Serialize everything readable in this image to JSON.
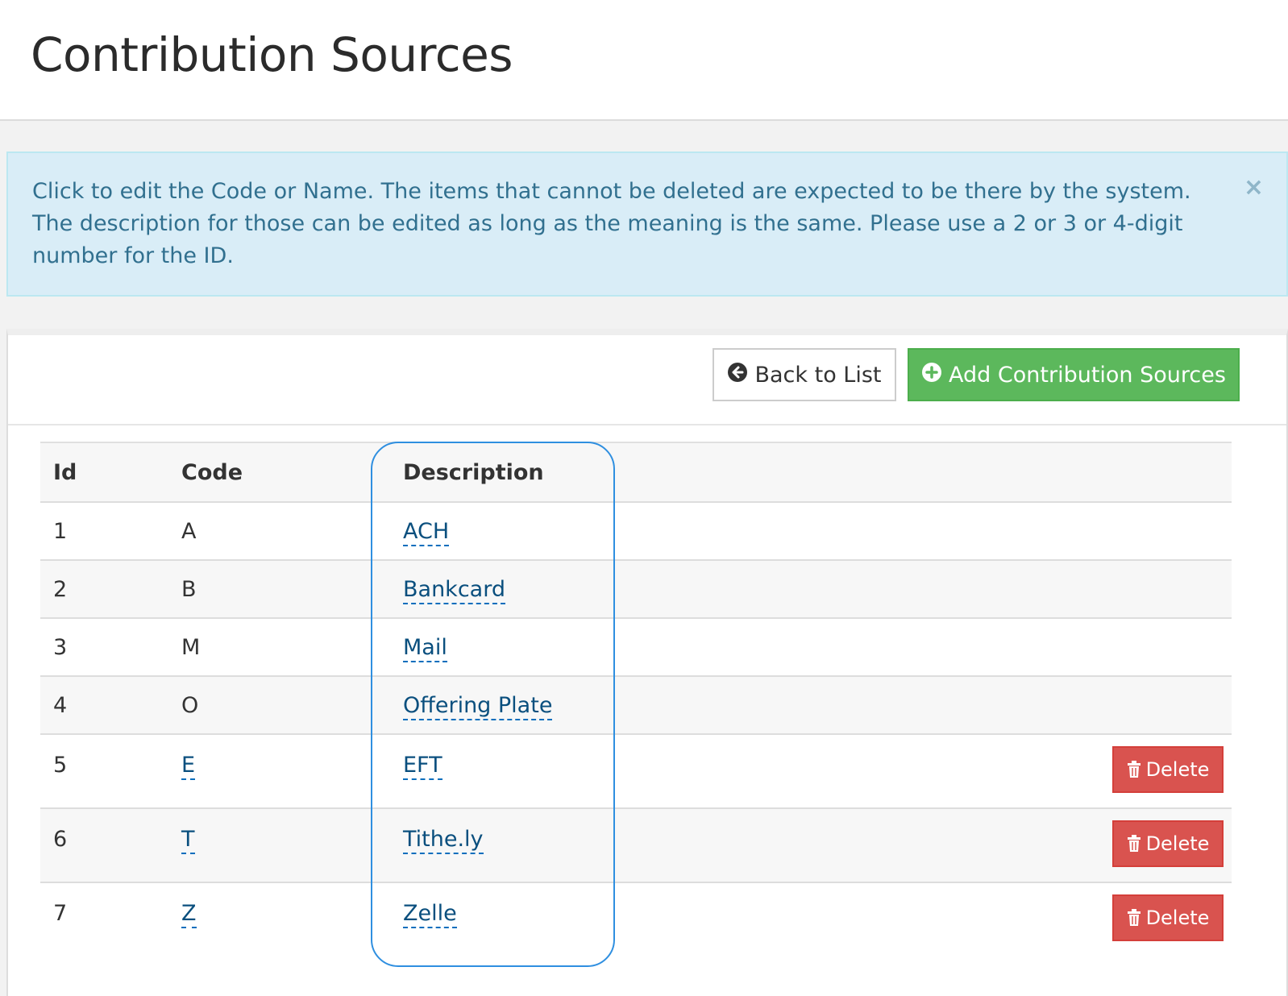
{
  "page": {
    "title": "Contribution Sources"
  },
  "alert": {
    "text": "Click to edit the Code or Name. The items that cannot be deleted are expected to be there by the system. The description for those can be edited as long as the meaning is the same. Please use a 2 or 3 or 4-digit number for the ID.",
    "close_glyph": "×"
  },
  "toolbar": {
    "back_label": "Back to List",
    "add_label": "Add Contribution Sources"
  },
  "table": {
    "headers": {
      "id": "Id",
      "code": "Code",
      "description": "Description"
    },
    "rows": [
      {
        "id": "1",
        "code": "A",
        "description": "ACH",
        "code_editable": false,
        "deletable": false
      },
      {
        "id": "2",
        "code": "B",
        "description": "Bankcard",
        "code_editable": false,
        "deletable": false
      },
      {
        "id": "3",
        "code": "M",
        "description": "Mail",
        "code_editable": false,
        "deletable": false
      },
      {
        "id": "4",
        "code": "O",
        "description": "Offering Plate",
        "code_editable": false,
        "deletable": false
      },
      {
        "id": "5",
        "code": "E",
        "description": "EFT",
        "code_editable": true,
        "deletable": true
      },
      {
        "id": "6",
        "code": "T",
        "description": "Tithe.ly",
        "code_editable": true,
        "deletable": true
      },
      {
        "id": "7",
        "code": "Z",
        "description": "Zelle",
        "code_editable": true,
        "deletable": true
      }
    ],
    "delete_label": "Delete"
  },
  "colors": {
    "alert_bg": "#d9edf7",
    "alert_text": "#31708f",
    "add_button": "#5cb85c",
    "delete_button": "#d9534f",
    "editable_link": "#0a4f7e",
    "highlight_outline": "#2f8fe0"
  },
  "icons": {
    "back": "arrow-circle-left-icon",
    "add": "plus-circle-icon",
    "delete": "trash-icon",
    "close": "close-icon"
  }
}
